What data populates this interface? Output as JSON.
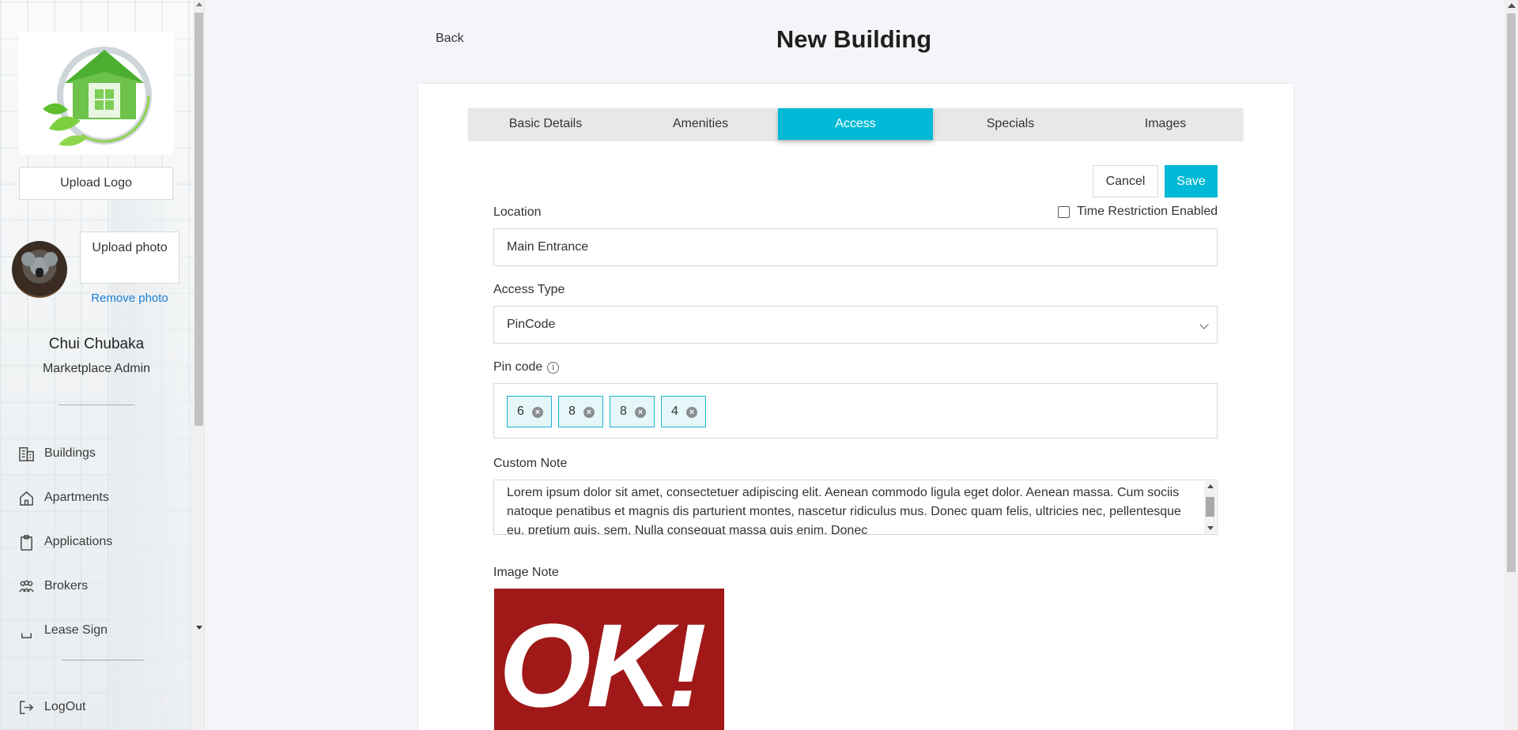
{
  "sidebar": {
    "upload_logo_label": "Upload Logo",
    "upload_photo_label": "Upload photo",
    "remove_photo_label": "Remove photo",
    "user_name": "Chui Chubaka",
    "user_role": "Marketplace Admin",
    "nav": [
      {
        "label": "Buildings",
        "icon": "buildings-icon"
      },
      {
        "label": "Apartments",
        "icon": "home-icon"
      },
      {
        "label": "Applications",
        "icon": "clipboard-icon"
      },
      {
        "label": "Brokers",
        "icon": "people-icon"
      },
      {
        "label": "Lease Sign",
        "icon": "document-icon"
      }
    ],
    "logout_label": "LogOut"
  },
  "header": {
    "back_label": "Back",
    "title": "New Building"
  },
  "tabs": [
    {
      "label": "Basic Details",
      "active": false
    },
    {
      "label": "Amenities",
      "active": false
    },
    {
      "label": "Access",
      "active": true
    },
    {
      "label": "Specials",
      "active": false
    },
    {
      "label": "Images",
      "active": false
    }
  ],
  "actions": {
    "cancel_label": "Cancel",
    "save_label": "Save"
  },
  "form": {
    "location_label": "Location",
    "location_value": "Main Entrance",
    "time_restriction_label": "Time Restriction Enabled",
    "time_restriction_checked": false,
    "access_type_label": "Access Type",
    "access_type_value": "PinCode",
    "pin_code_label": "Pin code",
    "pin_digits": [
      "6",
      "8",
      "8",
      "4"
    ],
    "custom_note_label": "Custom Note",
    "custom_note_value": "Lorem ipsum dolor sit amet, consectetuer adipiscing elit. Aenean commodo ligula eget dolor. Aenean massa. Cum sociis natoque penatibus et magnis dis parturient montes, nascetur ridiculus mus. Donec quam felis, ultricies nec, pellentesque eu, pretium quis, sem. Nulla consequat massa quis enim. Donec",
    "image_note_label": "Image Note",
    "image_note_logo_text": "OK!"
  },
  "colors": {
    "accent": "#00b9d6",
    "link": "#1b7fd6",
    "image_note_bg": "#a01818"
  }
}
